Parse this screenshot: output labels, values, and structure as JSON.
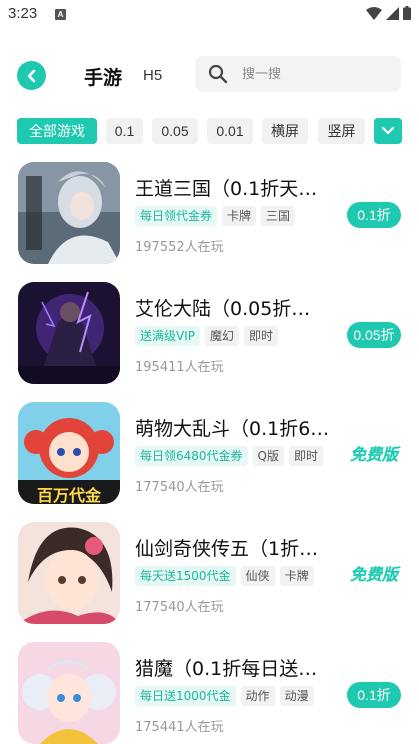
{
  "status_bar": {
    "time": "3:23",
    "notification_icon": "A"
  },
  "header": {
    "tabs": [
      {
        "label": "手游",
        "active": true
      },
      {
        "label": "H5",
        "active": false
      }
    ],
    "search": {
      "placeholder": "搜一搜"
    }
  },
  "filters": [
    {
      "label": "全部游戏",
      "active": true
    },
    {
      "label": "0.1",
      "active": false
    },
    {
      "label": "0.05",
      "active": false
    },
    {
      "label": "0.01",
      "active": false
    },
    {
      "label": "横屏",
      "active": false
    },
    {
      "label": "竖屏",
      "active": false
    }
  ],
  "games": [
    {
      "title": "王道三国（0.1折天…",
      "tags": [
        {
          "label": "每日领代金券",
          "type": "promo"
        },
        {
          "label": "卡牌",
          "type": "genre"
        },
        {
          "label": "三国",
          "type": "genre"
        }
      ],
      "players": "197552人在玩",
      "badge": {
        "type": "discount",
        "label": "0.1折"
      }
    },
    {
      "title": "艾伦大陆（0.05折…",
      "tags": [
        {
          "label": "送满级VIP",
          "type": "promo"
        },
        {
          "label": "魔幻",
          "type": "genre"
        },
        {
          "label": "即时",
          "type": "genre"
        }
      ],
      "players": "195411人在玩",
      "badge": {
        "type": "discount",
        "label": "0.05折"
      }
    },
    {
      "title": "萌物大乱斗（0.1折6…",
      "tags": [
        {
          "label": "每日领6480代金券",
          "type": "promo"
        },
        {
          "label": "Q版",
          "type": "genre"
        },
        {
          "label": "即时",
          "type": "genre"
        }
      ],
      "players": "177540人在玩",
      "badge": {
        "type": "free",
        "label": "免费版"
      },
      "thumb_text": "百万代金"
    },
    {
      "title": "仙剑奇侠传五（1折…",
      "tags": [
        {
          "label": "每天送1500代金",
          "type": "promo"
        },
        {
          "label": "仙侠",
          "type": "genre"
        },
        {
          "label": "卡牌",
          "type": "genre"
        }
      ],
      "players": "177540人在玩",
      "badge": {
        "type": "free",
        "label": "免费版"
      }
    },
    {
      "title": "猎魔（0.1折每日送…",
      "tags": [
        {
          "label": "每日送1000代金",
          "type": "promo"
        },
        {
          "label": "动作",
          "type": "genre"
        },
        {
          "label": "动漫",
          "type": "genre"
        }
      ],
      "players": "175441人在玩",
      "badge": {
        "type": "discount",
        "label": "0.1折"
      }
    }
  ],
  "colors": {
    "accent": "#1ec9b0",
    "promo_bg": "#e6f8f4",
    "chip_bg": "#f1f1f1"
  }
}
